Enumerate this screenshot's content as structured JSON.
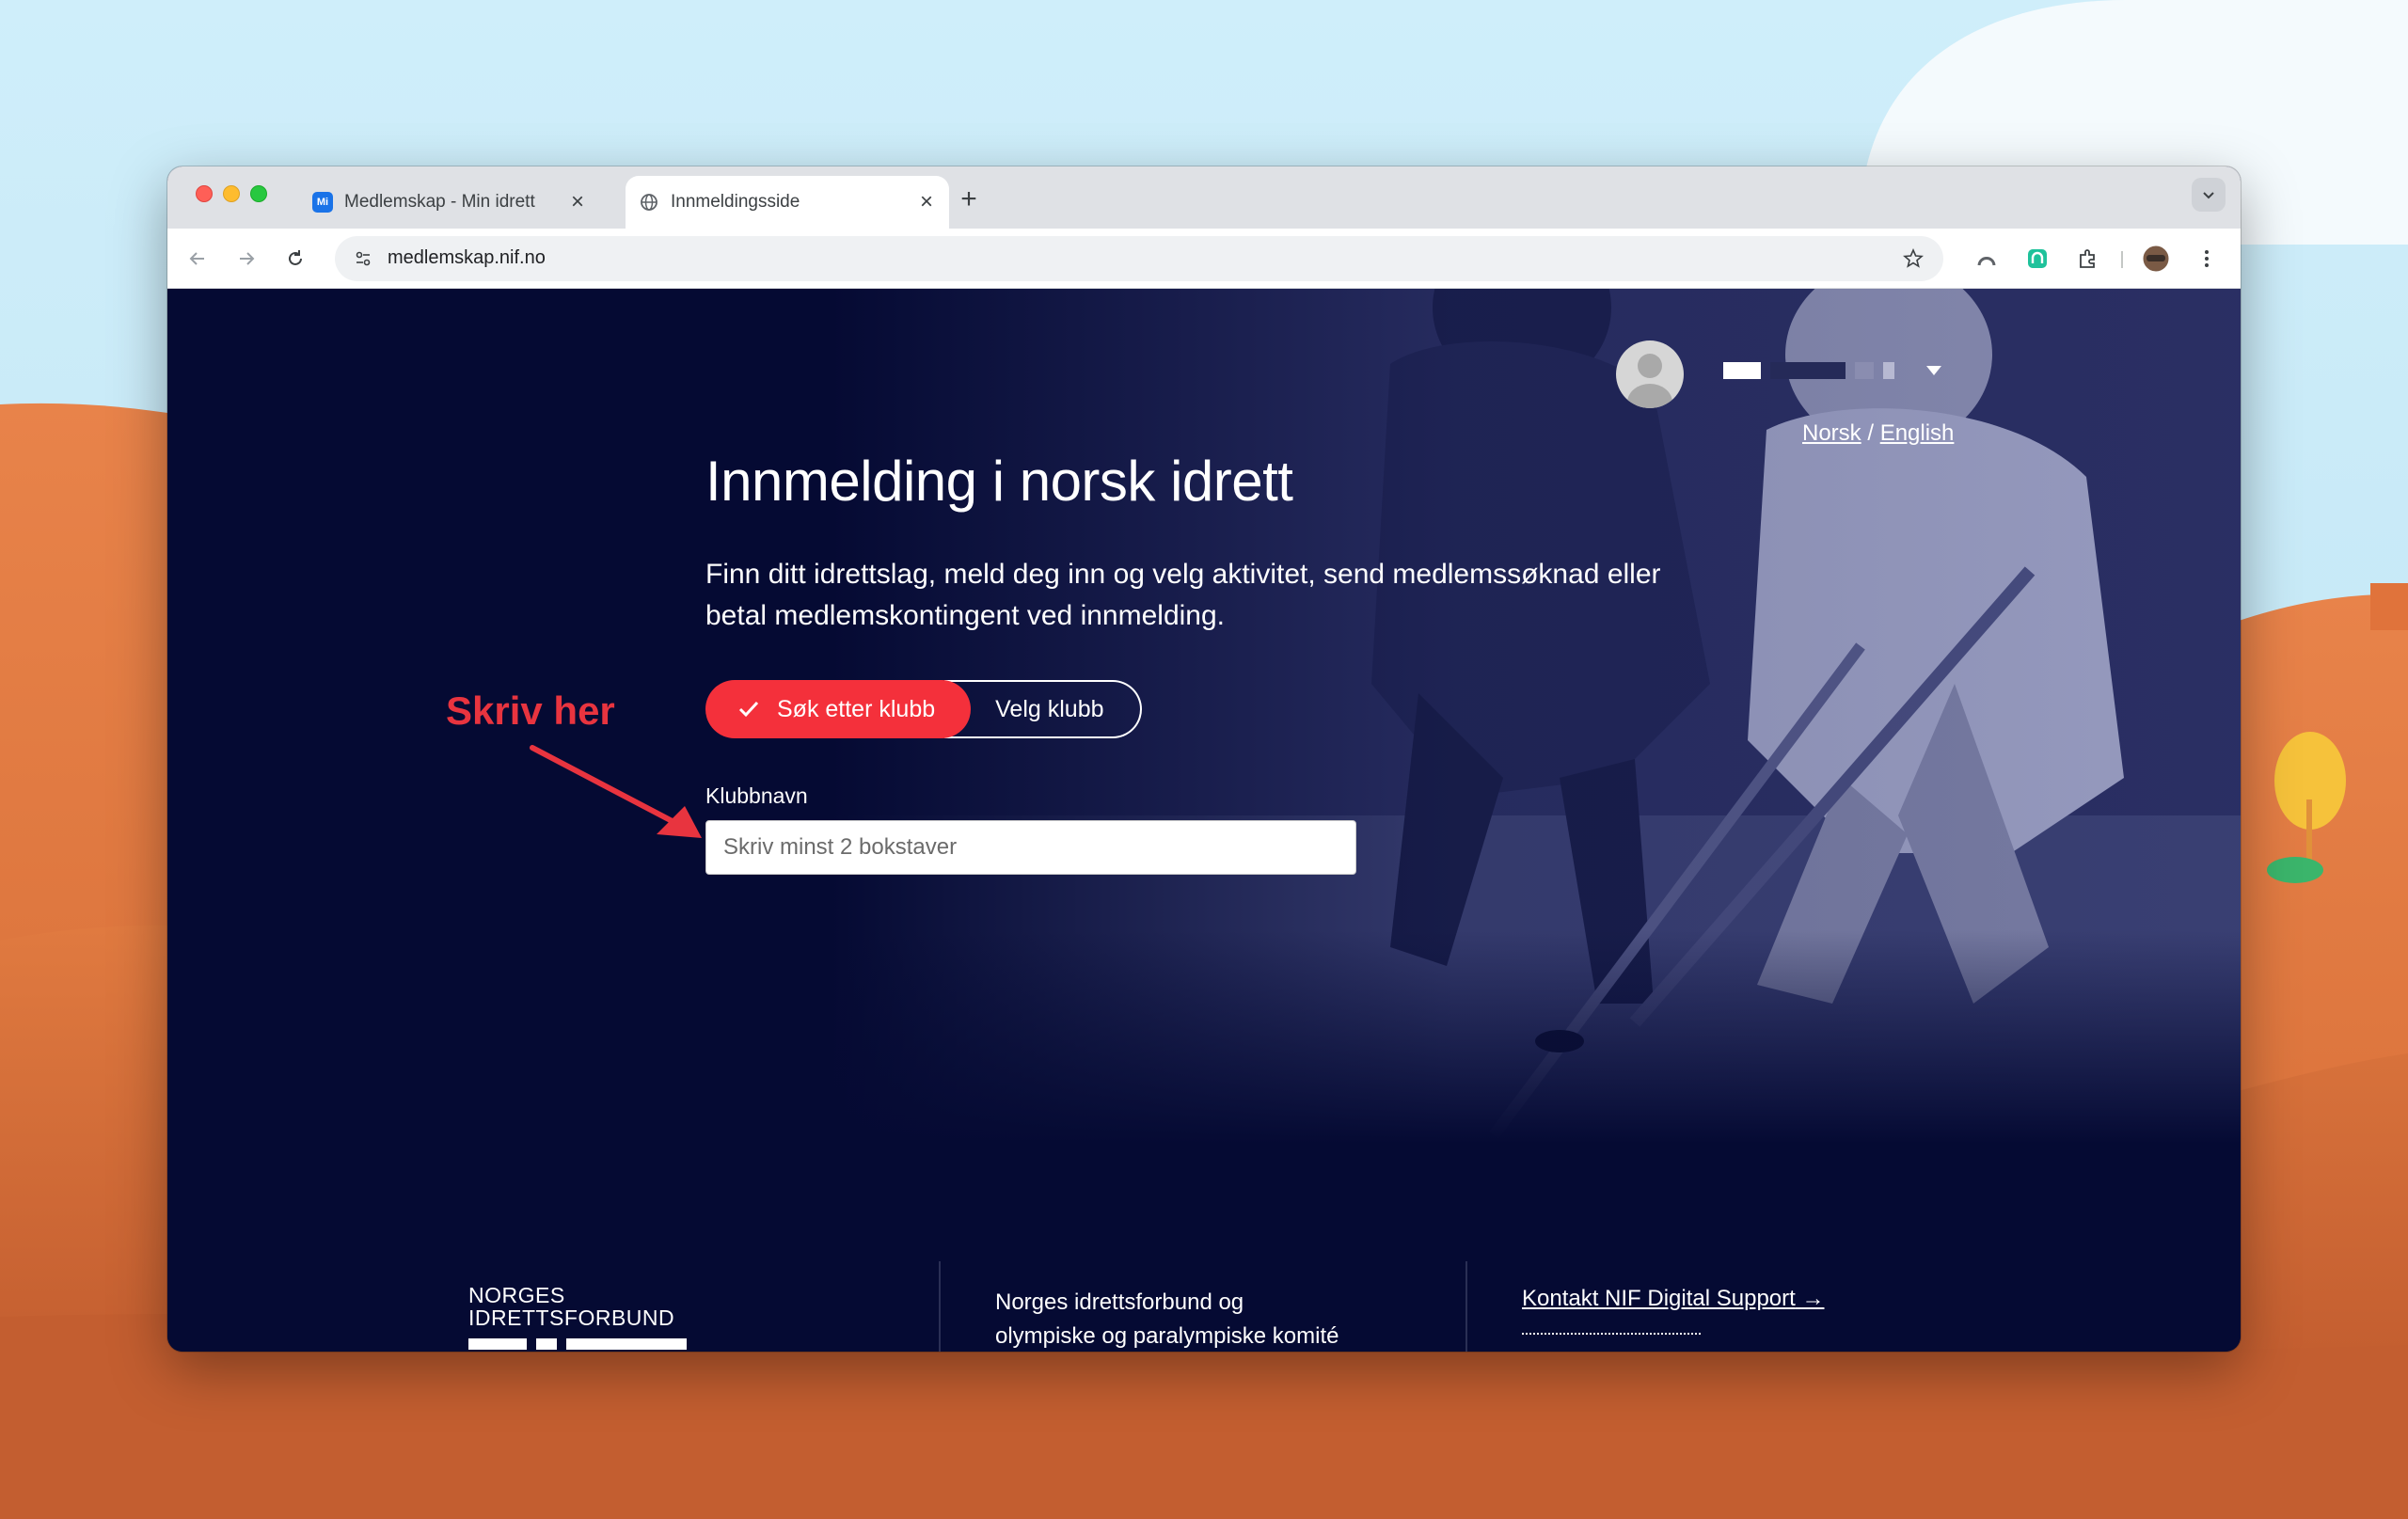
{
  "browser": {
    "tabs": [
      {
        "title": "Medlemskap - Min idrett",
        "favicon": "mi-app-icon",
        "active": false
      },
      {
        "title": "Innmeldingsside",
        "favicon": "globe-icon",
        "active": true
      }
    ],
    "url": "medlemskap.nif.no"
  },
  "header": {
    "language": {
      "norsk": "Norsk",
      "separator": "/",
      "english": "English"
    }
  },
  "hero": {
    "title": "Innmelding i norsk idrett",
    "lead": "Finn ditt idrettslag, meld deg inn og velg aktivitet, send medlemssøknad eller betal medlemskontingent ved innmelding.",
    "segment": {
      "search_label": "Søk etter klubb",
      "choose_label": "Velg klubb",
      "selected": "search"
    },
    "field": {
      "label": "Klubbnavn",
      "placeholder": "Skriv minst 2 bokstaver",
      "value": ""
    }
  },
  "annotation": {
    "text": "Skriv her",
    "color": "#e8343f"
  },
  "footer": {
    "logo_line1": "NORGES",
    "logo_line2": "IDRETTSFORBUND",
    "org_line1": "Norges idrettsforbund og",
    "org_line2": "olympiske og paralympiske komité",
    "support_link": "Kontakt NIF Digital Support",
    "support_arrow": "→"
  },
  "colors": {
    "page_bg": "#050a33",
    "accent": "#f4303b",
    "text": "#ffffff"
  }
}
